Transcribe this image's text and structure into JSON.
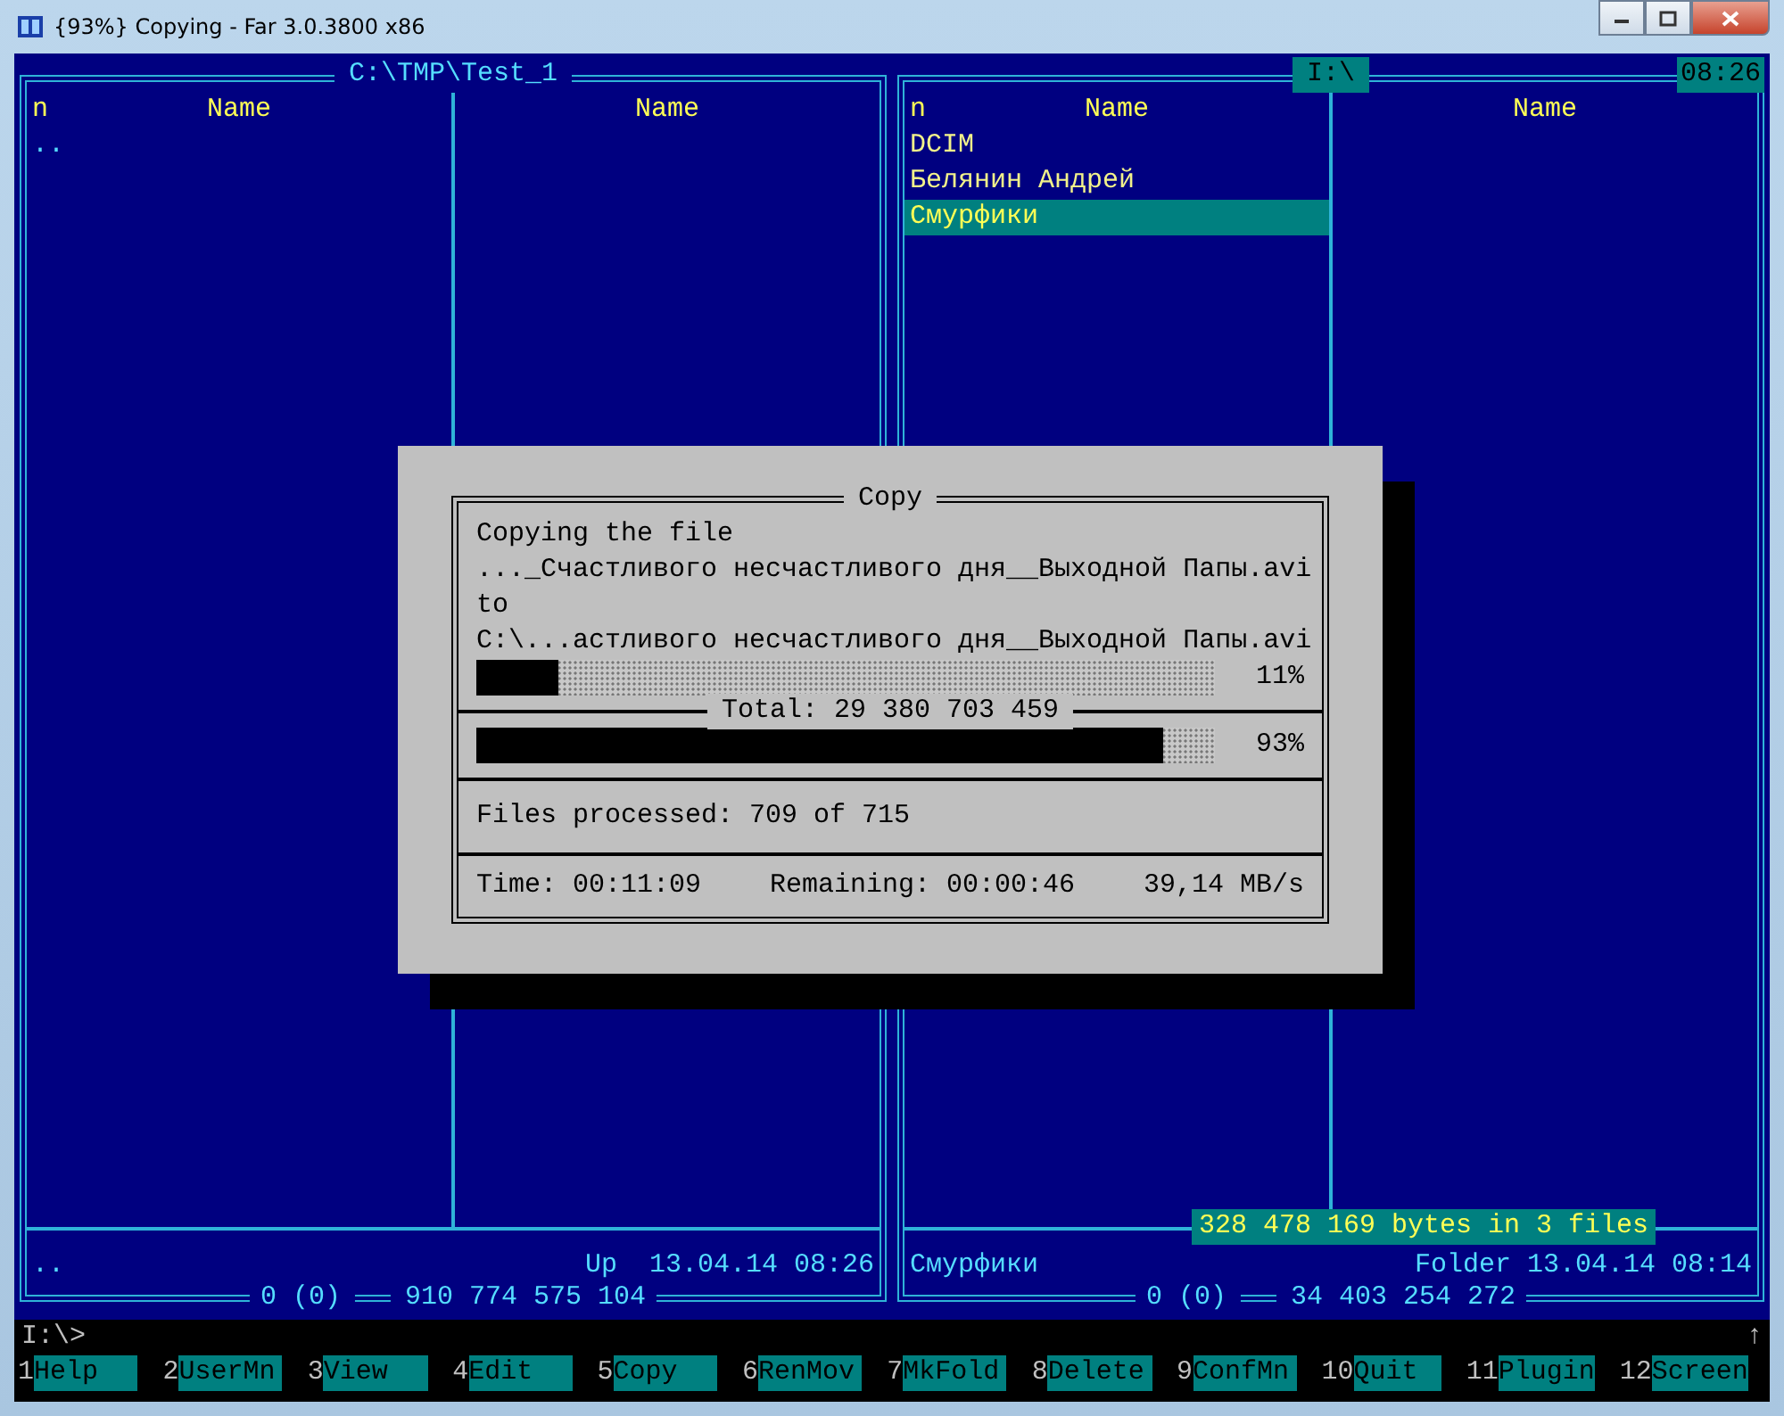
{
  "window": {
    "title": "{93%} Copying - Far 3.0.3800 x86"
  },
  "panels": [
    {
      "path": "C:\\TMP\\Test_1",
      "active": false,
      "column_headers": [
        "n",
        "Name",
        "Name"
      ],
      "files": [
        {
          "name": "..",
          "kind": "up",
          "selected": false
        }
      ],
      "info": {
        "name": "..",
        "details": "Up  13.04.14 08:26"
      },
      "totals": "0 (0)",
      "free": "910 774 575 104"
    },
    {
      "path": "I:\\",
      "active": true,
      "clock": "08:26",
      "column_headers": [
        "n",
        "Name",
        "Name"
      ],
      "files": [
        {
          "name": "DCIM",
          "kind": "folder",
          "selected": false
        },
        {
          "name": "Белянин Андрей",
          "kind": "folder",
          "selected": false
        },
        {
          "name": "Смурфики",
          "kind": "folder",
          "selected": true
        }
      ],
      "summary": "328 478 169 bytes in 3 files",
      "info": {
        "name": "Смурфики",
        "details": "Folder 13.04.14 08:14"
      },
      "totals": "0 (0)",
      "free": "34 403 254 272"
    }
  ],
  "dialog": {
    "title": "Copy",
    "source_label": "Copying the file",
    "source": "..._Счастливого несчастливого дня__Выходной Папы.avi",
    "target_label": "to",
    "target": "C:\\...астливого несчастливого дня__Выходной Папы.avi",
    "file_progress": {
      "level": 0.11,
      "reading": "11%"
    },
    "total_label": "Total: 29 380 703 459",
    "total_progress": {
      "level": 0.93,
      "reading": "93%"
    },
    "files_processed": "Files processed: 709 of 715",
    "time": "Time: 00:11:09",
    "remaining": "Remaining: 00:00:46",
    "speed": "39,14 MB/s"
  },
  "command_line": {
    "prompt": "I:\\>",
    "scroll_mark": "↑"
  },
  "keybar": [
    {
      "number": "1",
      "label": "Help"
    },
    {
      "number": "2",
      "label": "UserMn"
    },
    {
      "number": "3",
      "label": "View"
    },
    {
      "number": "4",
      "label": "Edit"
    },
    {
      "number": "5",
      "label": "Copy"
    },
    {
      "number": "6",
      "label": "RenMov"
    },
    {
      "number": "7",
      "label": "MkFold"
    },
    {
      "number": "8",
      "label": "Delete"
    },
    {
      "number": "9",
      "label": "ConfMn"
    },
    {
      "number": "10",
      "label": "Quit"
    },
    {
      "number": "11",
      "label": "Plugin"
    },
    {
      "number": "12",
      "label": "Screen"
    }
  ]
}
